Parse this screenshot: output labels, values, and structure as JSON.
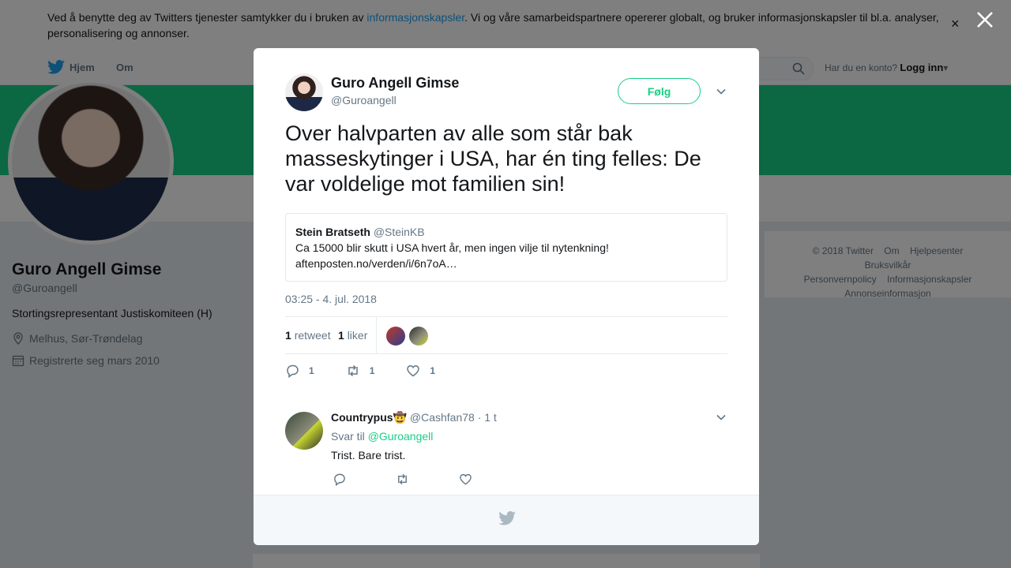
{
  "cookie_banner": {
    "text_before": "Ved å benytte deg av Twitters tjenester samtykker du i bruken av ",
    "link": "informasjonskapsler",
    "text_after": ". Vi og våre samarbeidspartnere opererer globalt, og bruker informasjonskapsler til bl.a. analyser, personalisering og annonser.",
    "close": "×"
  },
  "nav": {
    "home": "Hjem",
    "about": "Om",
    "account_prompt": "Har du en konto?",
    "login": "Logg inn"
  },
  "profile": {
    "name": "Guro Angell Gimse",
    "handle": "@Guroangell",
    "bio": "Stortingsrepresentant Justiskomiteen (H)",
    "location": "Melhus, Sør-Trøndelag",
    "joined": "Registrerte seg mars 2010"
  },
  "footer_links": [
    "© 2018 Twitter",
    "Om",
    "Hjelpesenter",
    "Bruksvilkår",
    "Personvernpolicy",
    "Informasjonskapsler",
    "Annonseinformasjon"
  ],
  "tweet": {
    "author_name": "Guro Angell Gimse",
    "author_handle": "@Guroangell",
    "follow_label": "Følg",
    "text": "Over halvparten av alle som står bak masseskytinger i USA, har én ting felles: De var voldelige mot familien sin!",
    "quote": {
      "name": "Stein Bratseth",
      "handle": "@SteinKB",
      "text": "Ca 15000 blir skutt i USA hvert år, men ingen vilje til nytenkning!",
      "link": "aftenposten.no/verden/i/6n7oA…"
    },
    "timestamp": "03:25 - 4. jul. 2018",
    "retweet_count": "1",
    "retweet_label": "retweet",
    "like_count": "1",
    "like_label": "liker",
    "reply_action_count": "1",
    "retweet_action_count": "1",
    "like_action_count": "1"
  },
  "reply": {
    "name": "Countrypus🤠",
    "handle": "@Cashfan78",
    "time": "· 1 t",
    "replying_to_label": "Svar til",
    "replying_to": "@Guroangell",
    "text": "Trist. Bare trist."
  },
  "colors": {
    "accent": "#19cf86",
    "twitter_blue": "#1da1f2",
    "text_secondary": "#657786"
  }
}
